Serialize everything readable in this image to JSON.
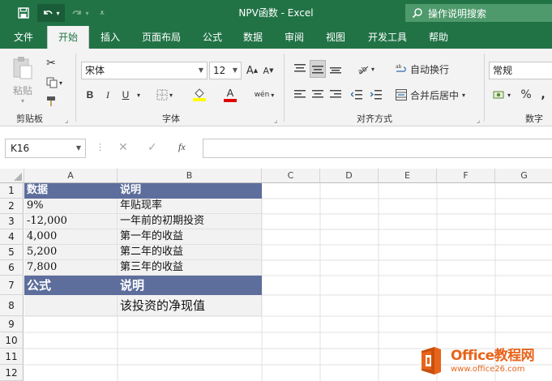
{
  "window": {
    "title": "NPV函数 - Excel"
  },
  "search": {
    "placeholder": "操作说明搜索"
  },
  "tabs": [
    {
      "label": "文件"
    },
    {
      "label": "开始",
      "active": true
    },
    {
      "label": "插入"
    },
    {
      "label": "页面布局"
    },
    {
      "label": "公式"
    },
    {
      "label": "数据"
    },
    {
      "label": "审阅"
    },
    {
      "label": "视图"
    },
    {
      "label": "开发工具"
    },
    {
      "label": "帮助"
    }
  ],
  "ribbon": {
    "clipboard": {
      "paste_label": "粘贴",
      "group_label": "剪贴板"
    },
    "font": {
      "font_name": "宋体",
      "font_size": "12",
      "group_label": "字体",
      "bold": "B",
      "italic": "I",
      "underline": "U",
      "wen": "wén",
      "grow": "A",
      "shrink": "A"
    },
    "alignment": {
      "wrap_label": "自动换行",
      "merge_label": "合并后居中",
      "group_label": "对齐方式"
    },
    "number": {
      "format": "常规",
      "group_label": "数字",
      "percent": "%",
      "comma": ","
    }
  },
  "formula_bar": {
    "name_box": "K16",
    "fx": "fx",
    "value": ""
  },
  "columns": [
    "A",
    "B",
    "C",
    "D",
    "E",
    "F",
    "G"
  ],
  "rows": [
    "1",
    "2",
    "3",
    "4",
    "5",
    "6",
    "7",
    "8",
    "9",
    "10",
    "11",
    "12"
  ],
  "cells": {
    "A1": "数据",
    "B1": "说明",
    "A2": "9%",
    "B2": "年贴现率",
    "A3": "-12,000",
    "B3": "一年前的初期投资",
    "A4": "4,000",
    "B4": "第一年的收益",
    "A5": "5,200",
    "B5": "第二年的收益",
    "A6": "7,800",
    "B6": "第三年的收益",
    "A7": "公式",
    "B7": "说明",
    "A8": "",
    "B8": "该投资的净现值"
  },
  "watermark": {
    "brand": "Office教程网",
    "url": "www.office26.com"
  },
  "colors": {
    "excel_green": "#217346",
    "header_fill": "#5d6e9c",
    "gray_fill": "#f2f2f2",
    "brand_orange": "#e8641b"
  }
}
